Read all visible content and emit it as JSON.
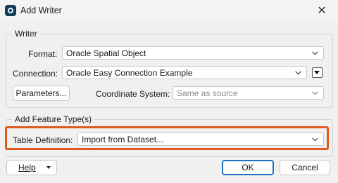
{
  "window": {
    "title": "Add Writer",
    "close_symbol": "✕"
  },
  "writer_group": {
    "legend": "Writer",
    "format_label": "Format:",
    "format_value": "Oracle Spatial Object",
    "connection_label": "Connection:",
    "connection_value": "Oracle Easy Connection Example",
    "parameters_label": "Parameters...",
    "coord_label": "Coordinate System:",
    "coord_value": "Same as source"
  },
  "feature_group": {
    "legend": "Add Feature Type(s)",
    "table_def_label": "Table Definition:",
    "table_def_value": "Import from Dataset..."
  },
  "footer": {
    "help_label": "Help",
    "ok_label": "OK",
    "cancel_label": "Cancel"
  },
  "colors": {
    "highlight": "#e05a1e",
    "primary_border": "#1f6fbf"
  }
}
